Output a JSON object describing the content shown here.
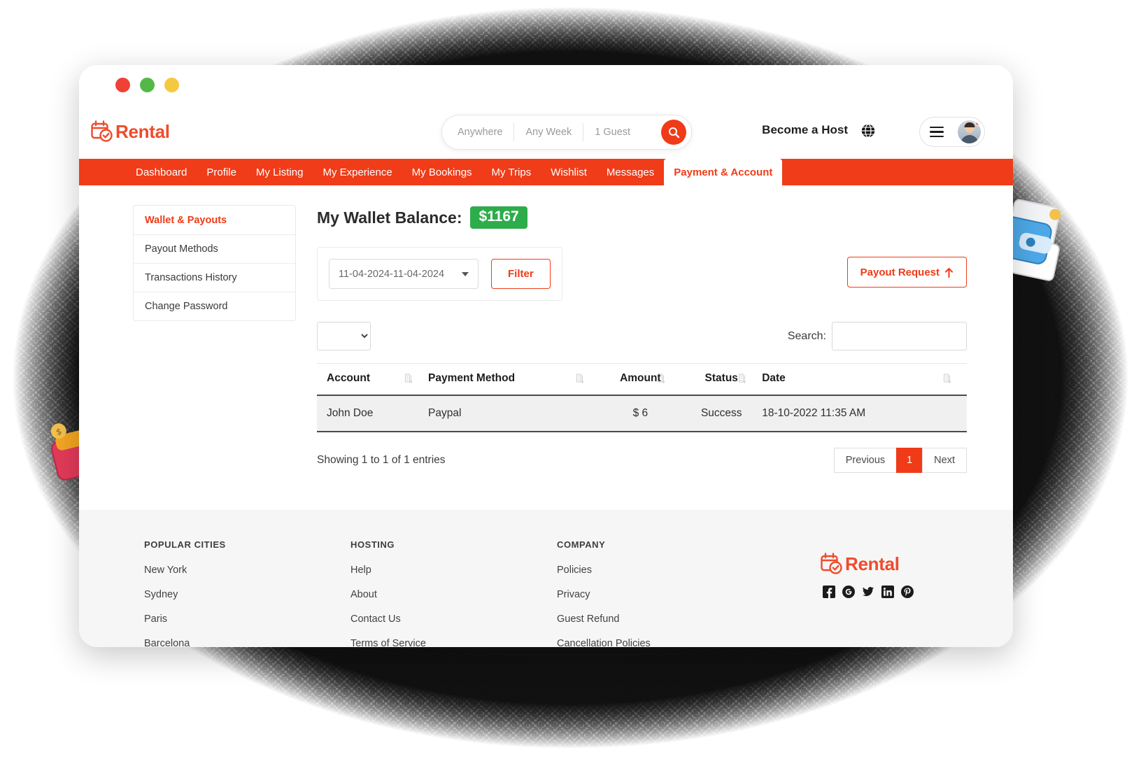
{
  "window": {
    "traffic_lights": [
      "close",
      "minimize",
      "maximize"
    ]
  },
  "header": {
    "brand_name": "Rental",
    "brand_icon": "calendar-check-icon",
    "search": {
      "location": "Anywhere",
      "dates": "Any Week",
      "guests": "1 Guest",
      "search_icon": "search-icon"
    },
    "become_host": "Become a Host",
    "globe_icon": "globe-icon",
    "menu_icon": "hamburger-icon",
    "avatar_icon": "user-avatar"
  },
  "nav": {
    "items": [
      {
        "label": "Dashboard",
        "active": false
      },
      {
        "label": "Profile",
        "active": false
      },
      {
        "label": "My Listing",
        "active": false
      },
      {
        "label": "My Experience",
        "active": false
      },
      {
        "label": "My Bookings",
        "active": false
      },
      {
        "label": "My Trips",
        "active": false
      },
      {
        "label": "Wishlist",
        "active": false
      },
      {
        "label": "Messages",
        "active": false
      },
      {
        "label": "Payment & Account",
        "active": true
      }
    ]
  },
  "sidebar": {
    "items": [
      {
        "label": "Wallet & Payouts",
        "active": true
      },
      {
        "label": "Payout Methods",
        "active": false
      },
      {
        "label": "Transactions History",
        "active": false
      },
      {
        "label": "Change Password",
        "active": false
      }
    ]
  },
  "wallet": {
    "label": "My Wallet Balance:",
    "balance": "$1167",
    "balance_color": "#2dac4a"
  },
  "filters": {
    "date_range": "11-04-2024-11-04-2024",
    "filter_button": "Filter",
    "payout_request_button": "Payout Request",
    "payout_request_icon": "arrow-up-icon"
  },
  "table_controls": {
    "length_value": "",
    "search_label": "Search:",
    "search_value": "",
    "search_placeholder": ""
  },
  "table": {
    "columns": [
      "Account",
      "Payment Method",
      "Amount",
      "Status",
      "Date"
    ],
    "sort_icon": "sort-icon",
    "rows": [
      {
        "account": "John Doe",
        "payment_method": "Paypal",
        "amount": "$ 6",
        "status": "Success",
        "date": "18-10-2022 11:35 AM"
      }
    ]
  },
  "pagination": {
    "info": "Showing 1 to 1 of 1 entries",
    "previous": "Previous",
    "current_page": "1",
    "next": "Next"
  },
  "footer": {
    "columns": [
      {
        "title": "POPULAR CITIES",
        "links": [
          "New York",
          "Sydney",
          "Paris",
          "Barcelona"
        ]
      },
      {
        "title": "HOSTING",
        "links": [
          "Help",
          "About",
          "Contact Us",
          "Terms of Service"
        ]
      },
      {
        "title": "COMPANY",
        "links": [
          "Policies",
          "Privacy",
          "Guest Refund",
          "Cancellation Policies"
        ]
      }
    ],
    "brand_name": "Rental",
    "socials": [
      "facebook-icon",
      "google-plus-icon",
      "twitter-icon",
      "linkedin-icon",
      "pinterest-icon"
    ]
  },
  "theme": {
    "accent": "#ef3b18",
    "nav_bg": "#f03c18",
    "success": "#2dac4a"
  }
}
